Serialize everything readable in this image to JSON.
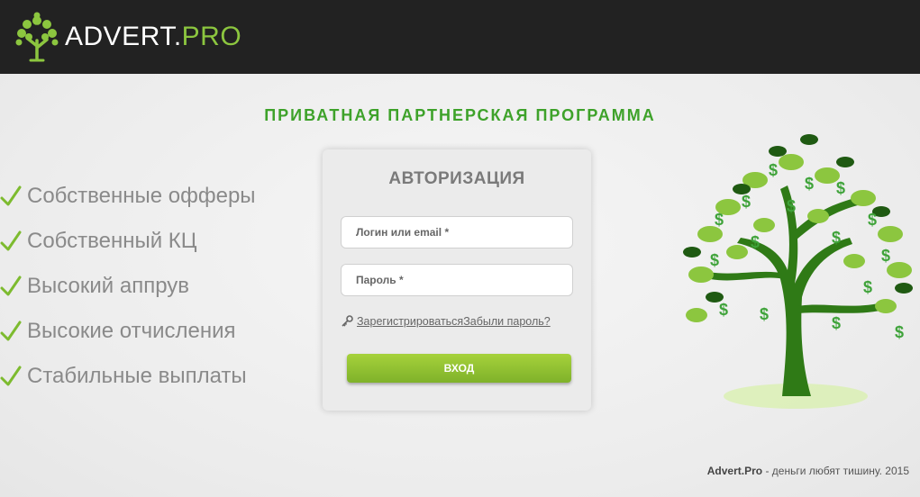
{
  "header": {
    "logo_main": "ADVERT",
    "logo_dot": ".",
    "logo_suffix": "PRO",
    "background": "#222222",
    "accent": "#8cc63f"
  },
  "headline": "ПРИВАТНАЯ ПАРТНЕРСКАЯ ПРОГРАММА",
  "features": [
    "Собственные офферы",
    "Собственный КЦ",
    "Высокий аппрув",
    "Высокие отчисления",
    "Стабильные выплаты"
  ],
  "login": {
    "title": "АВТОРИЗАЦИЯ",
    "login_placeholder": "Логин или email *",
    "password_placeholder": "Пароль *",
    "register_link": "Зарегистрироваться",
    "forgot_link": "Забыли пароль?",
    "submit_label": "ВХОД"
  },
  "footer": {
    "brand": "Advert.Pro",
    "tagline": " - деньги любят тишину. 2015"
  },
  "icons": {
    "logo": "money-tree-icon",
    "check": "checkmark-icon",
    "key": "key-icon",
    "tree": "money-tree-illustration"
  },
  "colors": {
    "headline_green": "#3ea22a",
    "button_green": "#8cc63f",
    "tree_dark": "#1f5a12"
  }
}
